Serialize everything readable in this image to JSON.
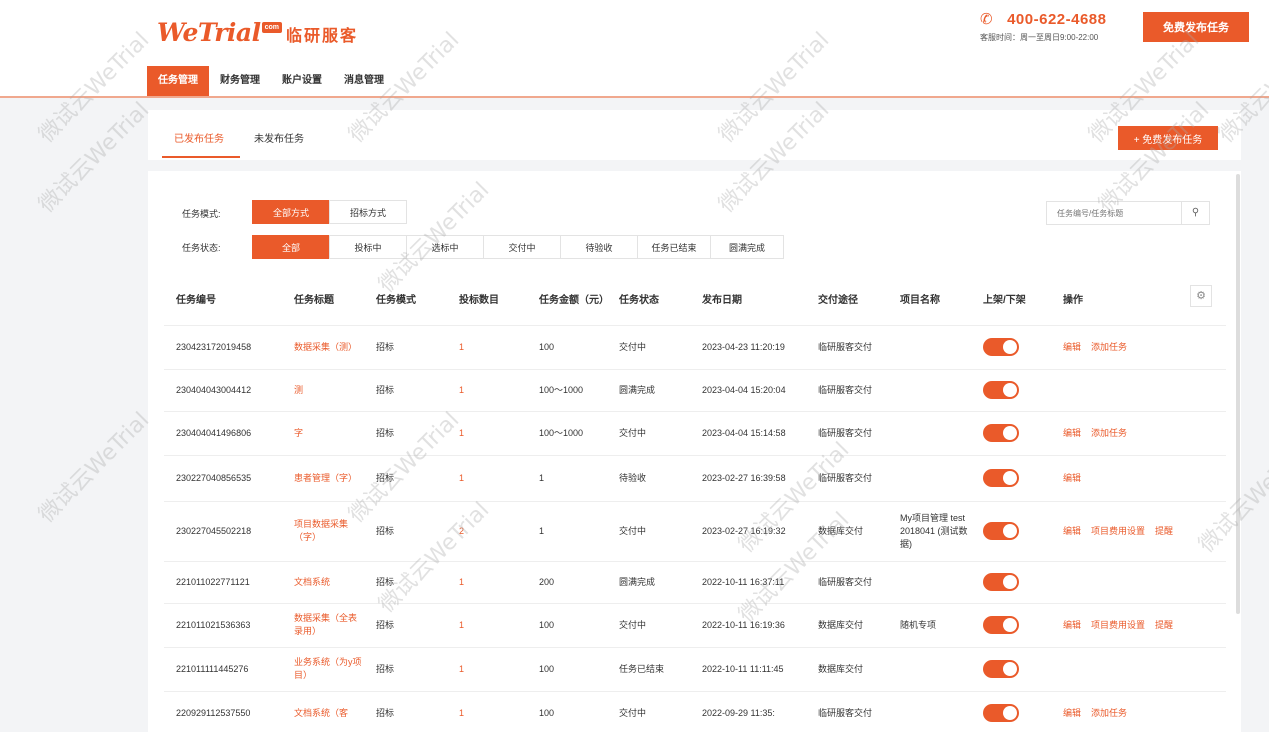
{
  "header": {
    "logo_text": "WeTrial",
    "logo_badge": "com",
    "logo_cn": "临研服客",
    "phone": "400-622-4688",
    "hours": "客服时间：周一至周日9:00-22:00",
    "free_button": "免费发布任务"
  },
  "nav": [
    "任务管理",
    "财务管理",
    "账户设置",
    "消息管理"
  ],
  "subtabs": [
    "已发布任务",
    "未发布任务"
  ],
  "new_task_button": "+ 免费发布任务",
  "filters": {
    "mode_label": "任务模式:",
    "modes": [
      "全部方式",
      "招标方式"
    ],
    "status_label": "任务状态:",
    "statuses": [
      "全部",
      "投标中",
      "选标中",
      "交付中",
      "待验收",
      "任务已结束",
      "圆满完成"
    ]
  },
  "search": {
    "placeholder": "任务编号/任务标题",
    "icon": "search-icon"
  },
  "settings_icon": "gear-icon",
  "table": {
    "headers": [
      "任务编号",
      "任务标题",
      "任务模式",
      "投标数目",
      "任务金额（元）",
      "任务状态",
      "发布日期",
      "交付途径",
      "项目名称",
      "上架/下架",
      "操作"
    ],
    "rows": [
      {
        "id": "230423172019458",
        "title": "数据采集（测）",
        "mode": "招标",
        "bids": "1",
        "amount": "100",
        "status": "交付中",
        "date": "2023-04-23 11:20:19",
        "delivery": "临研服客交付",
        "project": "",
        "ops": [
          "编辑",
          "添加任务"
        ]
      },
      {
        "id": "230404043004412",
        "title": "测",
        "mode": "招标",
        "bids": "1",
        "amount": "100～1000",
        "status": "圆满完成",
        "date": "2023-04-04 15:20:04",
        "delivery": "临研服客交付",
        "project": "",
        "ops": []
      },
      {
        "id": "230404041496806",
        "title": "字",
        "mode": "招标",
        "bids": "1",
        "amount": "100～1000",
        "status": "交付中",
        "date": "2023-04-04 15:14:58",
        "delivery": "临研服客交付",
        "project": "",
        "ops": [
          "编辑",
          "添加任务"
        ]
      },
      {
        "id": "230227040856535",
        "title": "患者管理（字）",
        "mode": "招标",
        "bids": "1",
        "amount": "1",
        "status": "待验收",
        "date": "2023-02-27 16:39:58",
        "delivery": "临研服客交付",
        "project": "",
        "ops": [
          "编辑"
        ]
      },
      {
        "id": "230227045502218",
        "title": "项目数据采集（字）",
        "mode": "招标",
        "bids": "2",
        "amount": "1",
        "status": "交付中",
        "date": "2023-02-27 16:19:32",
        "delivery": "数据库交付",
        "project": "My项目管理 test 2018041 (测试数据)",
        "ops": [
          "编辑",
          "项目费用设置",
          "提醒"
        ]
      },
      {
        "id": "221011022771121",
        "title": "文档系统",
        "mode": "招标",
        "bids": "1",
        "amount": "200",
        "status": "圆满完成",
        "date": "2022-10-11 16:37:11",
        "delivery": "临研服客交付",
        "project": "",
        "ops": []
      },
      {
        "id": "221011021536363",
        "title": "数据采集（全表录用）",
        "mode": "招标",
        "bids": "1",
        "amount": "100",
        "status": "交付中",
        "date": "2022-10-11 16:19:36",
        "delivery": "数据库交付",
        "project": "随机专项",
        "ops": [
          "编辑",
          "项目费用设置",
          "提醒"
        ]
      },
      {
        "id": "221011111445276",
        "title": "业务系统（为y项目）",
        "mode": "招标",
        "bids": "1",
        "amount": "100",
        "status": "任务已结束",
        "date": "2022-10-11 11:11:45",
        "delivery": "数据库交付",
        "project": "",
        "ops": []
      },
      {
        "id": "220929112537550",
        "title": "文档系统（客",
        "mode": "招标",
        "bids": "1",
        "amount": "100",
        "status": "交付中",
        "date": "2022-09-29 11:35:",
        "delivery": "临研服客交付",
        "project": "",
        "ops": [
          "编辑",
          "添加任务"
        ]
      }
    ]
  },
  "watermark": "微试云WeTrial",
  "colors": {
    "accent": "#ea5a2a",
    "background": "#f3f4f6"
  }
}
